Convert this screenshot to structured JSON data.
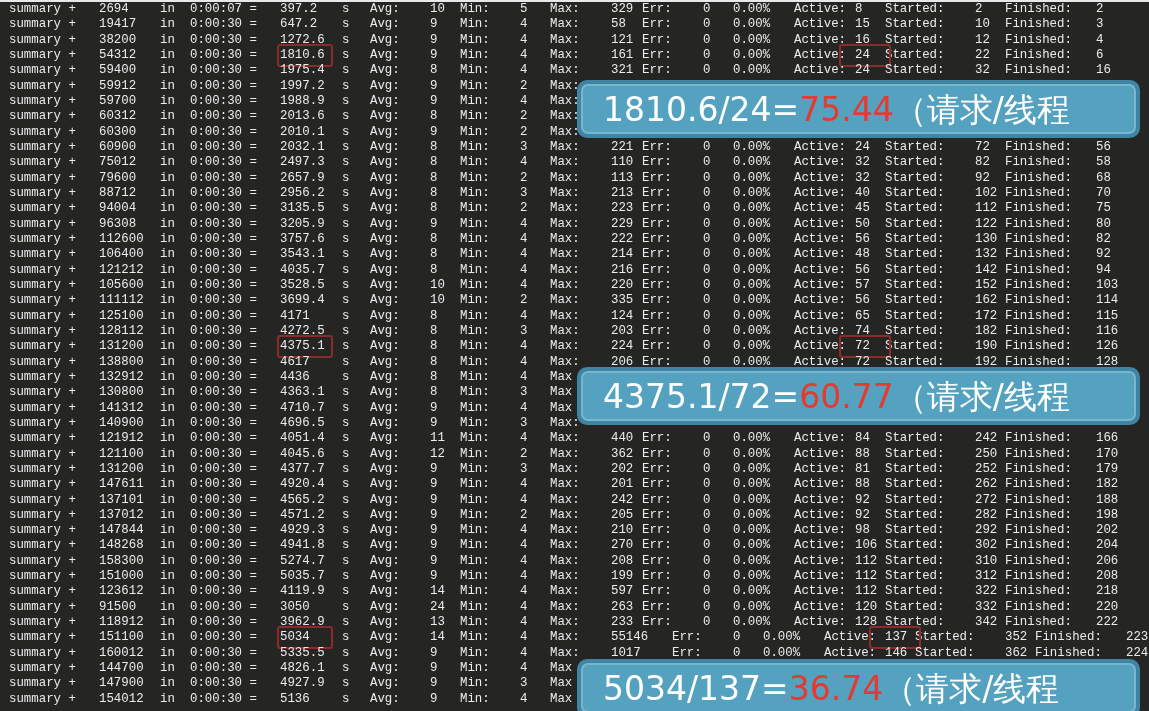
{
  "rows": [
    {
      "kind": "normal",
      "highlighted": false,
      "cells": [
        "summary +",
        "2694",
        "in",
        "0:00:07 =",
        "397.2",
        "s",
        "Avg:",
        "10",
        "Min:",
        "5",
        "Max:",
        "329",
        "Err:",
        "0",
        "0.00%",
        "Active:",
        "8",
        "Started:",
        "2",
        "Finished:",
        "2"
      ]
    },
    {
      "kind": "normal",
      "highlighted": false,
      "cells": [
        "summary +",
        "19417",
        "in",
        "0:00:30 =",
        "647.2",
        "s",
        "Avg:",
        "9",
        "Min:",
        "4",
        "Max:",
        "58",
        "Err:",
        "0",
        "0.00%",
        "Active:",
        "15",
        "Started:",
        "10",
        "Finished:",
        "3"
      ]
    },
    {
      "kind": "normal",
      "highlighted": false,
      "cells": [
        "summary +",
        "38200",
        "in",
        "0:00:30 =",
        "1272.6",
        "s",
        "Avg:",
        "9",
        "Min:",
        "4",
        "Max:",
        "121",
        "Err:",
        "0",
        "0.00%",
        "Active:",
        "16",
        "Started:",
        "12",
        "Finished:",
        "4"
      ]
    },
    {
      "kind": "normal",
      "highlighted": true,
      "cells": [
        "summary +",
        "54312",
        "in",
        "0:00:30 =",
        "1810.6",
        "s",
        "Avg:",
        "9",
        "Min:",
        "4",
        "Max:",
        "161",
        "Err:",
        "0",
        "0.00%",
        "Active:",
        "24",
        "Started:",
        "22",
        "Finished:",
        "6"
      ]
    },
    {
      "kind": "normal",
      "highlighted": false,
      "cells": [
        "summary +",
        "59400",
        "in",
        "0:00:30 =",
        "1975.4",
        "s",
        "Avg:",
        "8",
        "Min:",
        "4",
        "Max:",
        "321",
        "Err:",
        "0",
        "0.00%",
        "Active:",
        "24",
        "Started:",
        "32",
        "Finished:",
        "16"
      ]
    },
    {
      "kind": "normal",
      "highlighted": false,
      "cells": [
        "summary +",
        "59912",
        "in",
        "0:00:30 =",
        "1997.2",
        "s",
        "Avg:",
        "9",
        "Min:",
        "2",
        "Max:"
      ]
    },
    {
      "kind": "normal",
      "highlighted": false,
      "cells": [
        "summary +",
        "59700",
        "in",
        "0:00:30 =",
        "1988.9",
        "s",
        "Avg:",
        "9",
        "Min:",
        "4",
        "Max:"
      ]
    },
    {
      "kind": "normal",
      "highlighted": false,
      "cells": [
        "summary +",
        "60312",
        "in",
        "0:00:30 =",
        "2013.6",
        "s",
        "Avg:",
        "8",
        "Min:",
        "2",
        "Max:"
      ]
    },
    {
      "kind": "normal",
      "highlighted": false,
      "cells": [
        "summary +",
        "60300",
        "in",
        "0:00:30 =",
        "2010.1",
        "s",
        "Avg:",
        "9",
        "Min:",
        "2",
        "Max:"
      ]
    },
    {
      "kind": "normal",
      "highlighted": false,
      "cells": [
        "summary +",
        "60900",
        "in",
        "0:00:30 =",
        "2032.1",
        "s",
        "Avg:",
        "8",
        "Min:",
        "3",
        "Max:",
        "221",
        "Err:",
        "0",
        "0.00%",
        "Active:",
        "24",
        "Started:",
        "72",
        "Finished:",
        "56"
      ]
    },
    {
      "kind": "normal",
      "highlighted": false,
      "cells": [
        "summary +",
        "75012",
        "in",
        "0:00:30 =",
        "2497.3",
        "s",
        "Avg:",
        "8",
        "Min:",
        "4",
        "Max:",
        "110",
        "Err:",
        "0",
        "0.00%",
        "Active:",
        "32",
        "Started:",
        "82",
        "Finished:",
        "58"
      ]
    },
    {
      "kind": "normal",
      "highlighted": false,
      "cells": [
        "summary +",
        "79600",
        "in",
        "0:00:30 =",
        "2657.9",
        "s",
        "Avg:",
        "8",
        "Min:",
        "2",
        "Max:",
        "113",
        "Err:",
        "0",
        "0.00%",
        "Active:",
        "32",
        "Started:",
        "92",
        "Finished:",
        "68"
      ]
    },
    {
      "kind": "normal",
      "highlighted": false,
      "cells": [
        "summary +",
        "88712",
        "in",
        "0:00:30 =",
        "2956.2",
        "s",
        "Avg:",
        "8",
        "Min:",
        "3",
        "Max:",
        "213",
        "Err:",
        "0",
        "0.00%",
        "Active:",
        "40",
        "Started:",
        "102",
        "Finished:",
        "70"
      ]
    },
    {
      "kind": "normal",
      "highlighted": false,
      "cells": [
        "summary +",
        "94004",
        "in",
        "0:00:30 =",
        "3135.5",
        "s",
        "Avg:",
        "8",
        "Min:",
        "2",
        "Max:",
        "223",
        "Err:",
        "0",
        "0.00%",
        "Active:",
        "45",
        "Started:",
        "112",
        "Finished:",
        "75"
      ]
    },
    {
      "kind": "normal",
      "highlighted": false,
      "cells": [
        "summary +",
        "96308",
        "in",
        "0:00:30 =",
        "3205.9",
        "s",
        "Avg:",
        "9",
        "Min:",
        "4",
        "Max:",
        "229",
        "Err:",
        "0",
        "0.00%",
        "Active:",
        "50",
        "Started:",
        "122",
        "Finished:",
        "80"
      ]
    },
    {
      "kind": "normal",
      "highlighted": false,
      "cells": [
        "summary +",
        "112600",
        "in",
        "0:00:30 =",
        "3757.6",
        "s",
        "Avg:",
        "8",
        "Min:",
        "4",
        "Max:",
        "222",
        "Err:",
        "0",
        "0.00%",
        "Active:",
        "56",
        "Started:",
        "130",
        "Finished:",
        "82"
      ]
    },
    {
      "kind": "normal",
      "highlighted": false,
      "cells": [
        "summary +",
        "106400",
        "in",
        "0:00:30 =",
        "3543.1",
        "s",
        "Avg:",
        "8",
        "Min:",
        "4",
        "Max:",
        "214",
        "Err:",
        "0",
        "0.00%",
        "Active:",
        "48",
        "Started:",
        "132",
        "Finished:",
        "92"
      ]
    },
    {
      "kind": "normal",
      "highlighted": false,
      "cells": [
        "summary +",
        "121212",
        "in",
        "0:00:30 =",
        "4035.7",
        "s",
        "Avg:",
        "8",
        "Min:",
        "4",
        "Max:",
        "216",
        "Err:",
        "0",
        "0.00%",
        "Active:",
        "56",
        "Started:",
        "142",
        "Finished:",
        "94"
      ]
    },
    {
      "kind": "normal",
      "highlighted": false,
      "cells": [
        "summary +",
        "105600",
        "in",
        "0:00:30 =",
        "3528.5",
        "s",
        "Avg:",
        "10",
        "Min:",
        "4",
        "Max:",
        "220",
        "Err:",
        "0",
        "0.00%",
        "Active:",
        "57",
        "Started:",
        "152",
        "Finished:",
        "103"
      ]
    },
    {
      "kind": "normal",
      "highlighted": false,
      "cells": [
        "summary +",
        "111112",
        "in",
        "0:00:30 =",
        "3699.4",
        "s",
        "Avg:",
        "10",
        "Min:",
        "2",
        "Max:",
        "335",
        "Err:",
        "0",
        "0.00%",
        "Active:",
        "56",
        "Started:",
        "162",
        "Finished:",
        "114"
      ]
    },
    {
      "kind": "normal",
      "highlighted": false,
      "cells": [
        "summary +",
        "125100",
        "in",
        "0:00:30 =",
        "4171",
        "s",
        "Avg:",
        "8",
        "Min:",
        "4",
        "Max:",
        "124",
        "Err:",
        "0",
        "0.00%",
        "Active:",
        "65",
        "Started:",
        "172",
        "Finished:",
        "115"
      ]
    },
    {
      "kind": "normal",
      "highlighted": false,
      "cells": [
        "summary +",
        "128112",
        "in",
        "0:00:30 =",
        "4272.5",
        "s",
        "Avg:",
        "8",
        "Min:",
        "3",
        "Max:",
        "203",
        "Err:",
        "0",
        "0.00%",
        "Active:",
        "74",
        "Started:",
        "182",
        "Finished:",
        "116"
      ]
    },
    {
      "kind": "normal",
      "highlighted": true,
      "cells": [
        "summary +",
        "131200",
        "in",
        "0:00:30 =",
        "4375.1",
        "s",
        "Avg:",
        "8",
        "Min:",
        "4",
        "Max:",
        "224",
        "Err:",
        "0",
        "0.00%",
        "Active:",
        "72",
        "Started:",
        "190",
        "Finished:",
        "126"
      ]
    },
    {
      "kind": "normal",
      "highlighted": false,
      "cells": [
        "summary +",
        "138800",
        "in",
        "0:00:30 =",
        "4617",
        "s",
        "Avg:",
        "8",
        "Min:",
        "4",
        "Max:",
        "206",
        "Err:",
        "0",
        "0.00%",
        "Active:",
        "72",
        "Started:",
        "192",
        "Finished:",
        "128"
      ]
    },
    {
      "kind": "normal",
      "highlighted": false,
      "cells": [
        "summary +",
        "132912",
        "in",
        "0:00:30 =",
        "4436",
        "s",
        "Avg:",
        "8",
        "Min:",
        "4",
        "Max"
      ]
    },
    {
      "kind": "normal",
      "highlighted": false,
      "cells": [
        "summary +",
        "130800",
        "in",
        "0:00:30 =",
        "4363.1",
        "s",
        "Avg:",
        "8",
        "Min:",
        "3",
        "Max"
      ]
    },
    {
      "kind": "normal",
      "highlighted": false,
      "cells": [
        "summary +",
        "141312",
        "in",
        "0:00:30 =",
        "4710.7",
        "s",
        "Avg:",
        "9",
        "Min:",
        "4",
        "Max"
      ]
    },
    {
      "kind": "normal",
      "highlighted": false,
      "cells": [
        "summary +",
        "140900",
        "in",
        "0:00:30 =",
        "4696.5",
        "s",
        "Avg:",
        "9",
        "Min:",
        "3",
        "Max:"
      ]
    },
    {
      "kind": "normal",
      "highlighted": false,
      "cells": [
        "summary +",
        "121912",
        "in",
        "0:00:30 =",
        "4051.4",
        "s",
        "Avg:",
        "11",
        "Min:",
        "4",
        "Max:",
        "440",
        "Err:",
        "0",
        "0.00%",
        "Active:",
        "84",
        "Started:",
        "242",
        "Finished:",
        "166"
      ]
    },
    {
      "kind": "normal",
      "highlighted": false,
      "cells": [
        "summary +",
        "121100",
        "in",
        "0:00:30 =",
        "4045.6",
        "s",
        "Avg:",
        "12",
        "Min:",
        "2",
        "Max:",
        "362",
        "Err:",
        "0",
        "0.00%",
        "Active:",
        "88",
        "Started:",
        "250",
        "Finished:",
        "170"
      ]
    },
    {
      "kind": "normal",
      "highlighted": false,
      "cells": [
        "summary +",
        "131200",
        "in",
        "0:00:30 =",
        "4377.7",
        "s",
        "Avg:",
        "9",
        "Min:",
        "3",
        "Max:",
        "202",
        "Err:",
        "0",
        "0.00%",
        "Active:",
        "81",
        "Started:",
        "252",
        "Finished:",
        "179"
      ]
    },
    {
      "kind": "normal",
      "highlighted": false,
      "cells": [
        "summary +",
        "147611",
        "in",
        "0:00:30 =",
        "4920.4",
        "s",
        "Avg:",
        "9",
        "Min:",
        "4",
        "Max:",
        "201",
        "Err:",
        "0",
        "0.00%",
        "Active:",
        "88",
        "Started:",
        "262",
        "Finished:",
        "182"
      ]
    },
    {
      "kind": "normal",
      "highlighted": false,
      "cells": [
        "summary +",
        "137101",
        "in",
        "0:00:30 =",
        "4565.2",
        "s",
        "Avg:",
        "9",
        "Min:",
        "4",
        "Max:",
        "242",
        "Err:",
        "0",
        "0.00%",
        "Active:",
        "92",
        "Started:",
        "272",
        "Finished:",
        "188"
      ]
    },
    {
      "kind": "normal",
      "highlighted": false,
      "cells": [
        "summary +",
        "137012",
        "in",
        "0:00:30 =",
        "4571.2",
        "s",
        "Avg:",
        "9",
        "Min:",
        "2",
        "Max:",
        "205",
        "Err:",
        "0",
        "0.00%",
        "Active:",
        "92",
        "Started:",
        "282",
        "Finished:",
        "198"
      ]
    },
    {
      "kind": "normal",
      "highlighted": false,
      "cells": [
        "summary +",
        "147844",
        "in",
        "0:00:30 =",
        "4929.3",
        "s",
        "Avg:",
        "9",
        "Min:",
        "4",
        "Max:",
        "210",
        "Err:",
        "0",
        "0.00%",
        "Active:",
        "98",
        "Started:",
        "292",
        "Finished:",
        "202"
      ]
    },
    {
      "kind": "normal",
      "highlighted": false,
      "cells": [
        "summary +",
        "148268",
        "in",
        "0:00:30 =",
        "4941.8",
        "s",
        "Avg:",
        "9",
        "Min:",
        "4",
        "Max:",
        "270",
        "Err:",
        "0",
        "0.00%",
        "Active:",
        "106",
        "Started:",
        "302",
        "Finished:",
        "204"
      ]
    },
    {
      "kind": "normal",
      "highlighted": false,
      "cells": [
        "summary +",
        "158300",
        "in",
        "0:00:30 =",
        "5274.7",
        "s",
        "Avg:",
        "9",
        "Min:",
        "4",
        "Max:",
        "208",
        "Err:",
        "0",
        "0.00%",
        "Active:",
        "112",
        "Started:",
        "310",
        "Finished:",
        "206"
      ]
    },
    {
      "kind": "normal",
      "highlighted": false,
      "cells": [
        "summary +",
        "151000",
        "in",
        "0:00:30 =",
        "5035.7",
        "s",
        "Avg:",
        "9",
        "Min:",
        "4",
        "Max:",
        "199",
        "Err:",
        "0",
        "0.00%",
        "Active:",
        "112",
        "Started:",
        "312",
        "Finished:",
        "208"
      ]
    },
    {
      "kind": "normal",
      "highlighted": false,
      "cells": [
        "summary +",
        "123612",
        "in",
        "0:00:30 =",
        "4119.9",
        "s",
        "Avg:",
        "14",
        "Min:",
        "4",
        "Max:",
        "597",
        "Err:",
        "0",
        "0.00%",
        "Active:",
        "112",
        "Started:",
        "322",
        "Finished:",
        "218"
      ]
    },
    {
      "kind": "normal",
      "highlighted": false,
      "cells": [
        "summary +",
        "91500",
        "in",
        "0:00:30 =",
        "3050",
        "s",
        "Avg:",
        "24",
        "Min:",
        "4",
        "Max:",
        "263",
        "Err:",
        "0",
        "0.00%",
        "Active:",
        "120",
        "Started:",
        "332",
        "Finished:",
        "220"
      ]
    },
    {
      "kind": "normal",
      "highlighted": false,
      "cells": [
        "summary +",
        "118912",
        "in",
        "0:00:30 =",
        "3962.9",
        "s",
        "Avg:",
        "13",
        "Min:",
        "4",
        "Max:",
        "233",
        "Err:",
        "0",
        "0.00%",
        "Active:",
        "128",
        "Started:",
        "342",
        "Finished:",
        "222"
      ]
    },
    {
      "kind": "wide",
      "highlighted": true,
      "cells": [
        "summary +",
        "151100",
        "in",
        "0:00:30 =",
        "5034",
        "s",
        "Avg:",
        "14",
        "Min:",
        "4",
        "Max:",
        "55146",
        "Err:",
        "0",
        "0.00%",
        "Active:",
        "137",
        "Started:",
        "352",
        "Finished:",
        "223"
      ]
    },
    {
      "kind": "wide",
      "highlighted": false,
      "cells": [
        "summary +",
        "160012",
        "in",
        "0:00:30 =",
        "5335.5",
        "s",
        "Avg:",
        "9",
        "Min:",
        "4",
        "Max:",
        "1017",
        "Err:",
        "0",
        "0.00%",
        "Active:",
        "146",
        "Started:",
        "362",
        "Finished:",
        "224"
      ]
    },
    {
      "kind": "normal",
      "highlighted": false,
      "cells": [
        "summary +",
        "144700",
        "in",
        "0:00:30 =",
        "4826.1",
        "s",
        "Avg:",
        "9",
        "Min:",
        "4",
        "Max"
      ]
    },
    {
      "kind": "normal",
      "highlighted": false,
      "cells": [
        "summary +",
        "147900",
        "in",
        "0:00:30 =",
        "4927.9",
        "s",
        "Avg:",
        "9",
        "Min:",
        "3",
        "Max"
      ]
    },
    {
      "kind": "normal",
      "highlighted": false,
      "cells": [
        "summary +",
        "154012",
        "in",
        "0:00:30 =",
        "5136",
        "s",
        "Avg:",
        "9",
        "Min:",
        "4",
        "Max"
      ]
    }
  ],
  "callouts": [
    {
      "expression": "1810.6/24=",
      "result": "75.44",
      "unit": "（请求/线程"
    },
    {
      "expression": "4375.1/72=",
      "result": "60.77",
      "unit": "（请求/线程"
    },
    {
      "expression": "5034/137=",
      "result": "36.74",
      "unit": "（请求/线程"
    }
  ]
}
